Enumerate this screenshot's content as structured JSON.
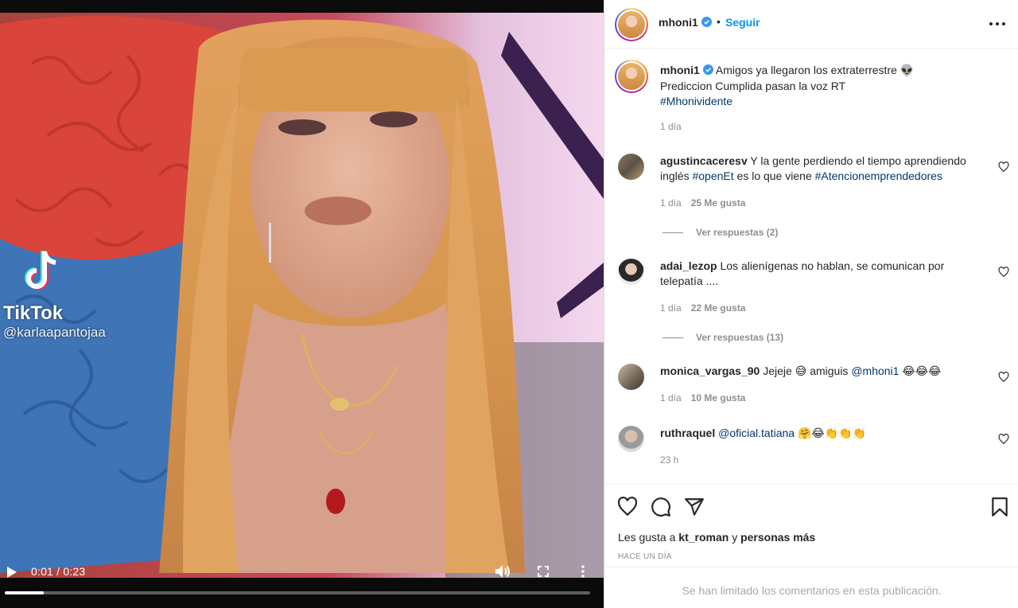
{
  "video": {
    "watermark_name": "TikTok",
    "watermark_handle": "@karlaapantojaa",
    "time_display": "0:01 / 0:23",
    "progress_fraction": 0.066
  },
  "post": {
    "username": "mhoni1",
    "dot": "•",
    "follow_label": "Seguir",
    "caption_username": "mhoni1",
    "caption_text": "Amigos ya llegaron los extraterrestre",
    "caption_emoji": "👽",
    "caption_line2": "Prediccion Cumplida pasan la voz RT",
    "caption_hashtag": "#Mhonividente",
    "caption_age": "1 día"
  },
  "comments": [
    {
      "username": "agustincaceresv",
      "text_a": "Y la gente perdiendo el tiempo aprendiendo inglés",
      "tag_a": "#openEt",
      "text_b": "es lo que viene",
      "tag_b": "#Atencionemprendedores",
      "age": "1 día",
      "likes": "25 Me gusta",
      "replies": "Ver respuestas (2)"
    },
    {
      "username": "adai_lezop",
      "text_a": "Los alienígenas no hablan, se comunican por telepatía ....",
      "age": "1 día",
      "likes": "22 Me gusta",
      "replies": "Ver respuestas (13)"
    },
    {
      "username": "monica_vargas_90",
      "text_a": "Jejeje",
      "emoji_a": "😅",
      "text_b": "amiguis",
      "tag_a": "@mhoni1",
      "emoji_b": "😂😂😂",
      "age": "1 día",
      "likes": "10 Me gusta"
    },
    {
      "username": "ruthraquel",
      "tag_a": "@oficial.tatiana",
      "emoji_a": "🤗😂👏👏👏",
      "age": "23 h"
    }
  ],
  "likes_line": {
    "prefix": "Les gusta a",
    "user": "kt_roman",
    "mid": "y",
    "rest": "personas más"
  },
  "timestamp": "HACE UN DÍA",
  "comments_limited": "Se han limitado los comentarios en esta publicación.",
  "colors": {
    "accent": "#0095f6",
    "link": "#00376b",
    "muted": "#8e8e8e",
    "verified": "#3897f0"
  },
  "icons": [
    "play-icon",
    "volume-icon",
    "fullscreen-icon",
    "more-vertical-icon",
    "more-horizontal-icon",
    "verified-badge-icon",
    "heart-icon",
    "comment-icon",
    "share-icon",
    "bookmark-icon",
    "tiktok-icon"
  ]
}
